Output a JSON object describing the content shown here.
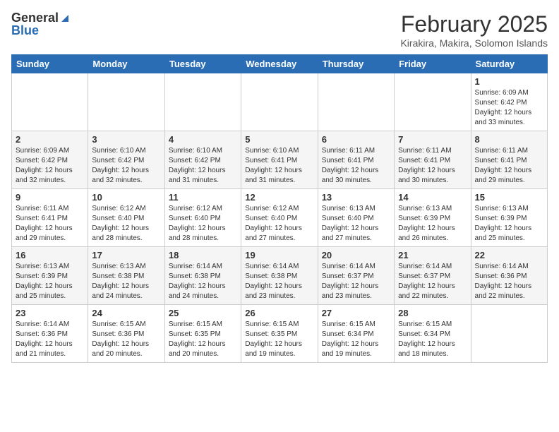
{
  "header": {
    "logo_general": "General",
    "logo_blue": "Blue",
    "month_title": "February 2025",
    "location": "Kirakira, Makira, Solomon Islands"
  },
  "weekdays": [
    "Sunday",
    "Monday",
    "Tuesday",
    "Wednesday",
    "Thursday",
    "Friday",
    "Saturday"
  ],
  "weeks": [
    [
      null,
      null,
      null,
      null,
      null,
      null,
      {
        "day": "1",
        "sunrise": "6:09 AM",
        "sunset": "6:42 PM",
        "daylight": "12 hours and 33 minutes."
      }
    ],
    [
      {
        "day": "2",
        "sunrise": "6:09 AM",
        "sunset": "6:42 PM",
        "daylight": "12 hours and 32 minutes."
      },
      {
        "day": "3",
        "sunrise": "6:10 AM",
        "sunset": "6:42 PM",
        "daylight": "12 hours and 32 minutes."
      },
      {
        "day": "4",
        "sunrise": "6:10 AM",
        "sunset": "6:42 PM",
        "daylight": "12 hours and 31 minutes."
      },
      {
        "day": "5",
        "sunrise": "6:10 AM",
        "sunset": "6:41 PM",
        "daylight": "12 hours and 31 minutes."
      },
      {
        "day": "6",
        "sunrise": "6:11 AM",
        "sunset": "6:41 PM",
        "daylight": "12 hours and 30 minutes."
      },
      {
        "day": "7",
        "sunrise": "6:11 AM",
        "sunset": "6:41 PM",
        "daylight": "12 hours and 30 minutes."
      },
      {
        "day": "8",
        "sunrise": "6:11 AM",
        "sunset": "6:41 PM",
        "daylight": "12 hours and 29 minutes."
      }
    ],
    [
      {
        "day": "9",
        "sunrise": "6:11 AM",
        "sunset": "6:41 PM",
        "daylight": "12 hours and 29 minutes."
      },
      {
        "day": "10",
        "sunrise": "6:12 AM",
        "sunset": "6:40 PM",
        "daylight": "12 hours and 28 minutes."
      },
      {
        "day": "11",
        "sunrise": "6:12 AM",
        "sunset": "6:40 PM",
        "daylight": "12 hours and 28 minutes."
      },
      {
        "day": "12",
        "sunrise": "6:12 AM",
        "sunset": "6:40 PM",
        "daylight": "12 hours and 27 minutes."
      },
      {
        "day": "13",
        "sunrise": "6:13 AM",
        "sunset": "6:40 PM",
        "daylight": "12 hours and 27 minutes."
      },
      {
        "day": "14",
        "sunrise": "6:13 AM",
        "sunset": "6:39 PM",
        "daylight": "12 hours and 26 minutes."
      },
      {
        "day": "15",
        "sunrise": "6:13 AM",
        "sunset": "6:39 PM",
        "daylight": "12 hours and 25 minutes."
      }
    ],
    [
      {
        "day": "16",
        "sunrise": "6:13 AM",
        "sunset": "6:39 PM",
        "daylight": "12 hours and 25 minutes."
      },
      {
        "day": "17",
        "sunrise": "6:13 AM",
        "sunset": "6:38 PM",
        "daylight": "12 hours and 24 minutes."
      },
      {
        "day": "18",
        "sunrise": "6:14 AM",
        "sunset": "6:38 PM",
        "daylight": "12 hours and 24 minutes."
      },
      {
        "day": "19",
        "sunrise": "6:14 AM",
        "sunset": "6:38 PM",
        "daylight": "12 hours and 23 minutes."
      },
      {
        "day": "20",
        "sunrise": "6:14 AM",
        "sunset": "6:37 PM",
        "daylight": "12 hours and 23 minutes."
      },
      {
        "day": "21",
        "sunrise": "6:14 AM",
        "sunset": "6:37 PM",
        "daylight": "12 hours and 22 minutes."
      },
      {
        "day": "22",
        "sunrise": "6:14 AM",
        "sunset": "6:36 PM",
        "daylight": "12 hours and 22 minutes."
      }
    ],
    [
      {
        "day": "23",
        "sunrise": "6:14 AM",
        "sunset": "6:36 PM",
        "daylight": "12 hours and 21 minutes."
      },
      {
        "day": "24",
        "sunrise": "6:15 AM",
        "sunset": "6:36 PM",
        "daylight": "12 hours and 20 minutes."
      },
      {
        "day": "25",
        "sunrise": "6:15 AM",
        "sunset": "6:35 PM",
        "daylight": "12 hours and 20 minutes."
      },
      {
        "day": "26",
        "sunrise": "6:15 AM",
        "sunset": "6:35 PM",
        "daylight": "12 hours and 19 minutes."
      },
      {
        "day": "27",
        "sunrise": "6:15 AM",
        "sunset": "6:34 PM",
        "daylight": "12 hours and 19 minutes."
      },
      {
        "day": "28",
        "sunrise": "6:15 AM",
        "sunset": "6:34 PM",
        "daylight": "12 hours and 18 minutes."
      },
      null
    ]
  ]
}
